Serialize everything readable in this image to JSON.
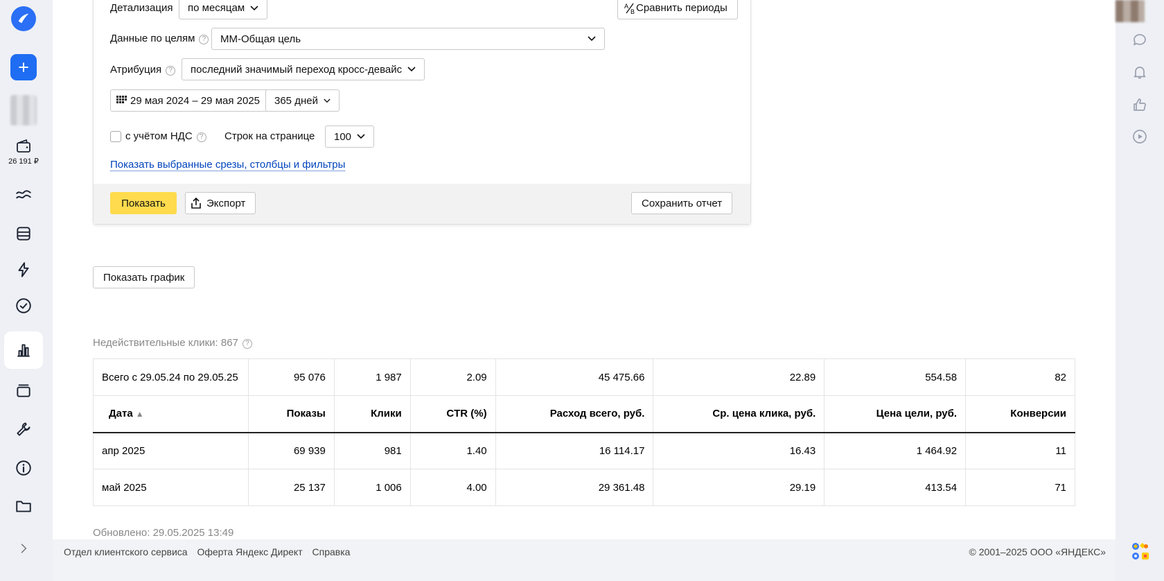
{
  "left_rail": {
    "balance": "26 191 ₽"
  },
  "filters": {
    "detail_label": "Детализация",
    "detail_value": "по месяцам",
    "compare_label": "Сравнить периоды",
    "goals_label": "Данные по целям",
    "goals_value": "ММ-Общая цель",
    "attribution_label": "Атрибуция",
    "attribution_value": "последний значимый переход кросс-девайс",
    "date_range": "29 мая 2024 – 29 мая 2025",
    "period_value": "365 дней",
    "vat_label": "с учётом НДС",
    "rows_label": "Строк на странице",
    "rows_value": "100",
    "show_selected_link": "Показать выбранные срезы, столбцы и фильтры",
    "show_button": "Показать",
    "export_button": "Экспорт",
    "save_report_button": "Сохранить отчет"
  },
  "show_chart_button": "Показать график",
  "invalid_clicks": "Недействительные клики: 867",
  "table": {
    "total": [
      "Всего с 29.05.24 по 29.05.25",
      "95 076",
      "1 987",
      "2.09",
      "45 475.66",
      "22.89",
      "554.58",
      "82"
    ],
    "headers": [
      "Дата",
      "Показы",
      "Клики",
      "CTR (%)",
      "Расход всего, руб.",
      "Ср. цена клика, руб.",
      "Цена цели, руб.",
      "Конверсии"
    ],
    "sort_indicator": "▲",
    "rows": [
      [
        "апр 2025",
        "69 939",
        "981",
        "1.40",
        "16 114.17",
        "16.43",
        "1 464.92",
        "11"
      ],
      [
        "май 2025",
        "25 137",
        "1 006",
        "4.00",
        "29 361.48",
        "29.19",
        "413.54",
        "71"
      ]
    ]
  },
  "updated": "Обновлено: 29.05.2025 13:49",
  "footer": {
    "links": [
      "Отдел клиентского сервиса",
      "Оферта Яндекс Директ",
      "Справка"
    ],
    "copyright": "© 2001–2025 ООО «ЯНДЕКС»"
  },
  "colors": {
    "accent_blue": "#1f6df2",
    "show_button_yellow": "#ffdb4d",
    "link_blue": "#0044bb",
    "rail_bg": "#eef0f5"
  }
}
